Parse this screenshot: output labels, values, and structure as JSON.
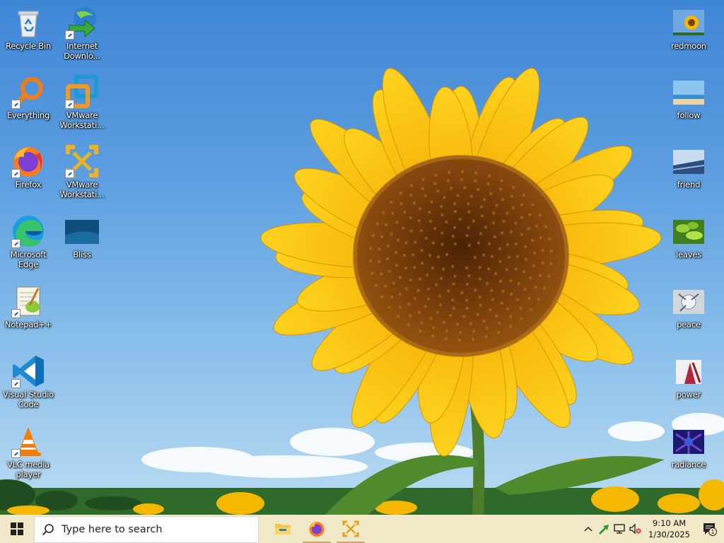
{
  "desktop": {
    "left_icons": [
      {
        "label": "Recycle Bin",
        "icon": "recycle-bin-icon"
      },
      {
        "label": "Internet Downlo...",
        "icon": "internet-download-manager-icon"
      },
      {
        "label": "Everything",
        "icon": "everything-search-icon"
      },
      {
        "label": "VMware Workstati...",
        "icon": "vmware-workstation-icon"
      },
      {
        "label": "Firefox",
        "icon": "firefox-icon"
      },
      {
        "label": "VMware Workstati...",
        "icon": "vmware-workstation-player-icon"
      },
      {
        "label": "Microsoft Edge",
        "icon": "edge-icon"
      },
      {
        "label": "Bliss",
        "icon": "bliss-image-icon"
      },
      {
        "label": "Notepad++",
        "icon": "notepad-plus-plus-icon"
      },
      {
        "label": "Visual Studio Code",
        "icon": "vscode-icon"
      },
      {
        "label": "VLC media player",
        "icon": "vlc-icon"
      }
    ],
    "right_icons": [
      {
        "label": "redmoon",
        "icon": "image-thumbnail-icon"
      },
      {
        "label": "follow",
        "icon": "image-thumbnail-icon"
      },
      {
        "label": "friend",
        "icon": "image-thumbnail-icon"
      },
      {
        "label": "leaves",
        "icon": "image-thumbnail-icon"
      },
      {
        "label": "peace",
        "icon": "image-thumbnail-icon"
      },
      {
        "label": "power",
        "icon": "image-thumbnail-icon"
      },
      {
        "label": "radiance",
        "icon": "image-thumbnail-icon"
      }
    ]
  },
  "taskbar": {
    "search_placeholder": "Type here to search",
    "pinned": [
      {
        "name": "file-explorer",
        "icon": "folder-icon"
      },
      {
        "name": "firefox",
        "icon": "firefox-icon"
      },
      {
        "name": "vmware",
        "icon": "vmware-workstation-player-icon"
      }
    ],
    "clock_time": "9:10 AM",
    "clock_date": "1/30/2025",
    "notification_count": "1"
  },
  "colors": {
    "taskbar_bg": "#f0e8c6",
    "sky_top": "#3f86d6",
    "petal": "#f5b800",
    "seed": "#7a3f0c"
  }
}
